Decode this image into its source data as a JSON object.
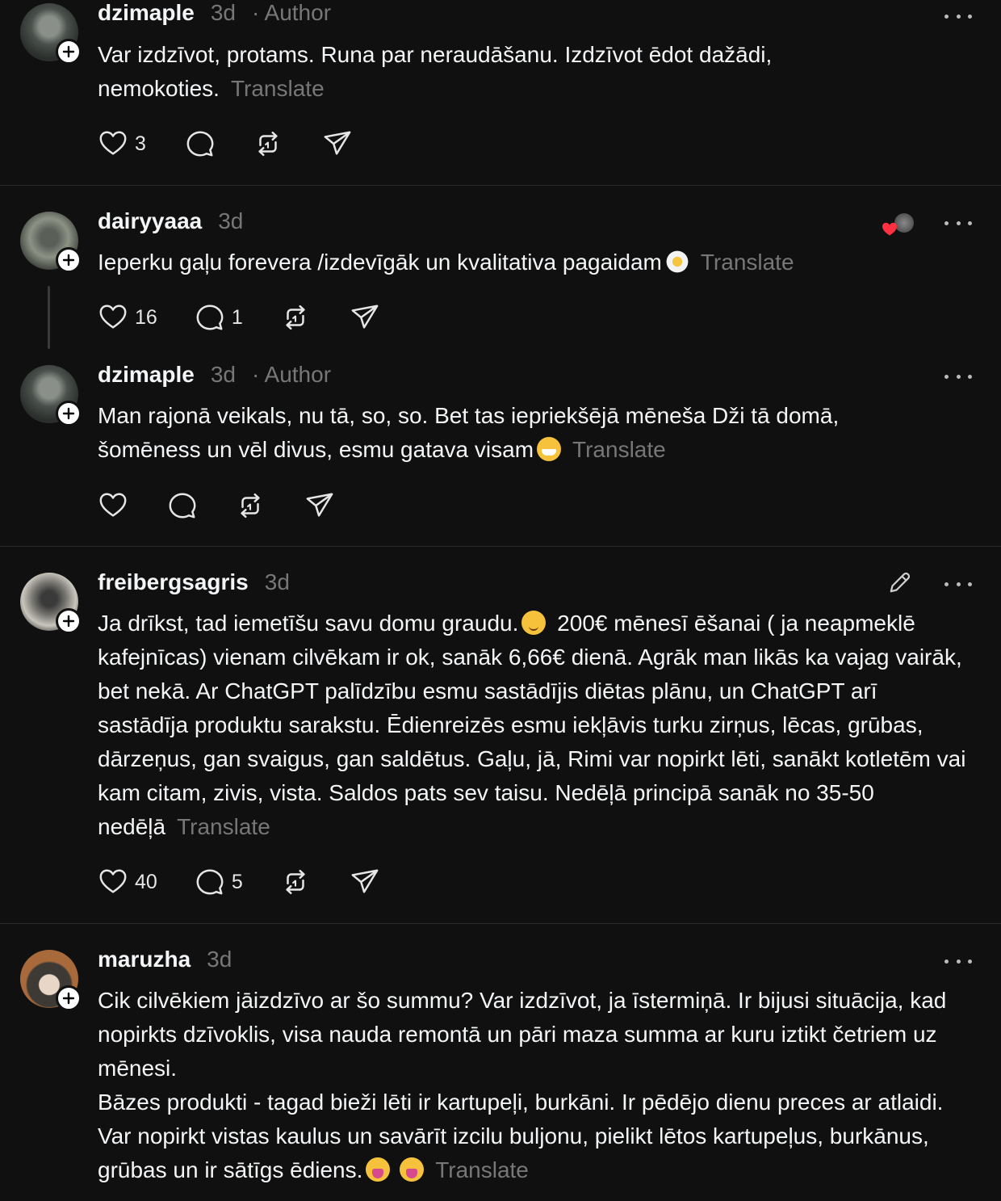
{
  "posts": [
    {
      "username": "dzimaple",
      "time": "3d",
      "author_label": "· Author",
      "text": "Var izdzīvot, protams. Runa par neraudāšanu. Izdzīvot ēdot dažādi,\nnemokoties.",
      "translate": "Translate",
      "likes": "3",
      "replies": "",
      "avatar_icon": "avatar-photo"
    },
    {
      "username": "dairyyaaa",
      "time": "3d",
      "text": "Ieperku gaļu forevera /izdevīgāk un kvalitativa pagaidam",
      "emoji": "flower",
      "translate": "Translate",
      "likes": "16",
      "replies": "1",
      "avatar_icon": "avatar-photo"
    },
    {
      "username": "dzimaple",
      "time": "3d",
      "author_label": "· Author",
      "text_line1": "Man rajonā veikals, nu tā, so, so. Bet tas iepriekšējā mēneša Dži tā domā,",
      "text_line2": "šomēness un vēl divus, esmu gatava visam",
      "emoji": "grin",
      "translate": "Translate",
      "likes": "",
      "replies": "",
      "avatar_icon": "avatar-photo"
    },
    {
      "username": "freibergsagris",
      "time": "3d",
      "text_lead": "Ja drīkst, tad iemetīšu savu domu graudu.",
      "emoji": "blush",
      "text_line1_rest": "200€ mēnesī ēšanai ( ja neapmeklē",
      "text_rest": "kafejnīcas) vienam cilvēkam ir ok, sanāk 6,66€ dienā. Agrāk man likās ka vajag vairāk, bet nekā. Ar ChatGPT palīdzību esmu sastādījis diētas plānu, un ChatGPT arī sastādīja produktu sarakstu. Ēdienreizēs esmu iekļāvis turku zirņus, lēcas, grūbas, dārzeņus, gan svaigus, gan saldētus. Gaļu, jā, Rimi var nopirkt lēti, sanākt kotletēm vai kam citam, zivis, vista. Saldos pats sev taisu. Nedēļā principā sanāk no 35-50 nedēļā",
      "translate": "Translate",
      "likes": "40",
      "replies": "5",
      "avatar_icon": "avatar-photo"
    },
    {
      "username": "maruzha",
      "time": "3d",
      "text_p1": "Cik cilvēkiem jāizdzīvo ar šo summu? Var izdzīvot, ja īstermiņā. Ir bijusi situācija, kad nopirkts dzīvoklis, visa nauda remontā un pāri maza summa ar kuru iztikt četriem uz mēnesi.",
      "text_p2": "Bāzes produkti - tagad bieži lēti ir kartupeļi, burkāni. Ir pēdējo dienu preces ar atlaidi. Var nopirkt vistas kaulus un savārīt izcilu buljonu, pielikt lētos kartupeļus, burkānus, grūbas un ir sātīgs ēdiens.",
      "emoji": "tongue",
      "translate": "Translate",
      "avatar_icon": "avatar-photo"
    }
  ],
  "colors": {
    "background": "#101010",
    "text": "#f3f5f7",
    "muted": "#777777",
    "divider": "#2a2a2a",
    "heart_red": "#ff3040"
  },
  "icons": [
    "heart-icon",
    "comment-icon",
    "repost-icon",
    "share-icon",
    "more-icon",
    "follow-plus-icon",
    "edit-pencil-icon"
  ]
}
